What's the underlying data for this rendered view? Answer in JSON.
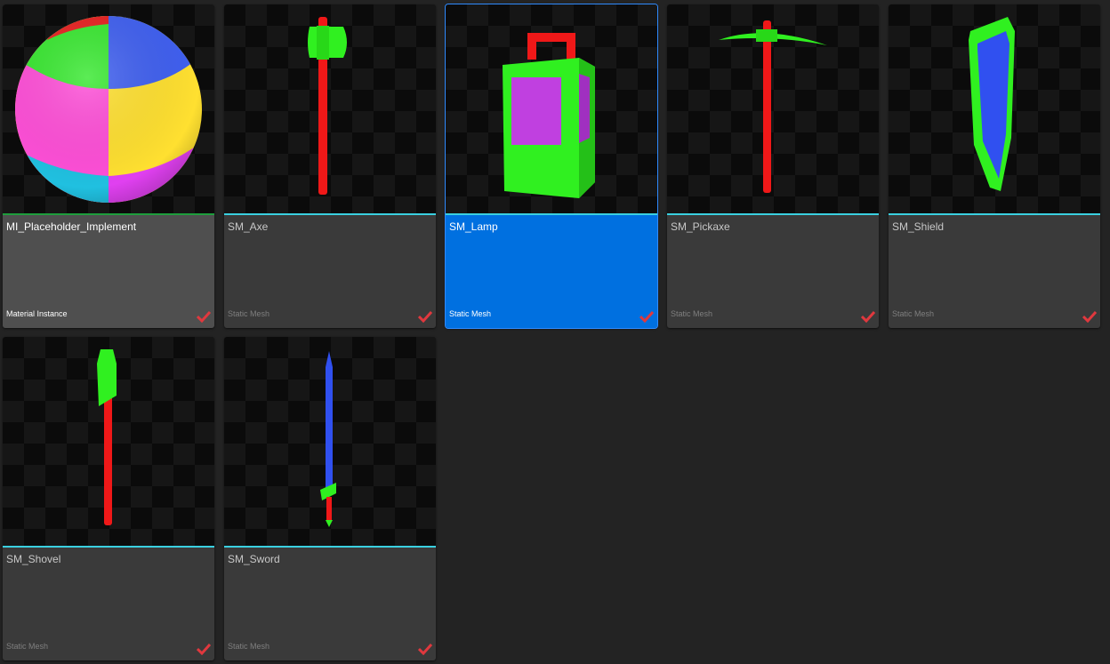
{
  "assets": [
    {
      "name": "MI_Placeholder_Implement",
      "type": "Material Instance",
      "state": "hovered",
      "checked": true,
      "thumbnail_icon": "sphere-material-icon"
    },
    {
      "name": "SM_Axe",
      "type": "Static Mesh",
      "state": "normal",
      "checked": true,
      "thumbnail_icon": "axe-mesh-icon"
    },
    {
      "name": "SM_Lamp",
      "type": "Static Mesh",
      "state": "selected",
      "checked": true,
      "thumbnail_icon": "lamp-mesh-icon"
    },
    {
      "name": "SM_Pickaxe",
      "type": "Static Mesh",
      "state": "normal",
      "checked": true,
      "thumbnail_icon": "pickaxe-mesh-icon"
    },
    {
      "name": "SM_Shield",
      "type": "Static Mesh",
      "state": "normal",
      "checked": true,
      "thumbnail_icon": "shield-mesh-icon"
    },
    {
      "name": "SM_Shovel",
      "type": "Static Mesh",
      "state": "normal",
      "checked": true,
      "thumbnail_icon": "shovel-mesh-icon"
    },
    {
      "name": "SM_Sword",
      "type": "Static Mesh",
      "state": "normal",
      "checked": true,
      "thumbnail_icon": "sword-mesh-icon"
    }
  ],
  "colors": {
    "background": "#232323",
    "tile": "#3a3a3a",
    "tile_hovered": "#4f4f4f",
    "tile_selected": "#0070e0",
    "mesh_strip": "#3ad0e0",
    "material_strip": "#1e9e3c",
    "check": "#e0383e"
  }
}
